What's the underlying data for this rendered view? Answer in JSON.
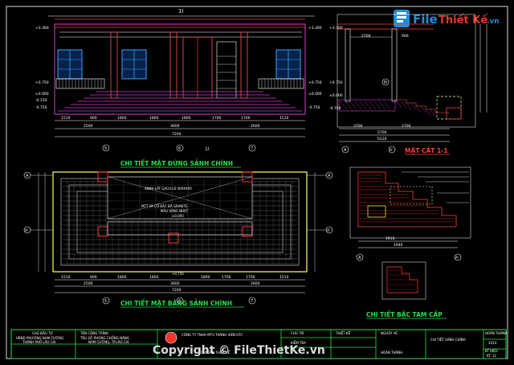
{
  "watermark": {
    "logo_word1": "File",
    "logo_word2": "Thiết Kế",
    "logo_domain": ".vn",
    "copyright": "Copyright © FileThietKe.vn"
  },
  "elevation": {
    "section_mark": "1I",
    "section_mark_bottom": "1I",
    "levels": [
      "+3.300",
      "+0.750",
      "±0.000",
      "-0.150",
      "-0.750"
    ],
    "dims_row1": [
      "1510",
      "900",
      "1800",
      "1800",
      "1800",
      "1700",
      "1700",
      "1510"
    ],
    "dims_row2": [
      "2500",
      "3600",
      "2600"
    ],
    "dims_row3": [
      "7200"
    ],
    "axes": [
      "5",
      "6",
      "7"
    ],
    "title": "CHI TIẾT MẶT ĐỨNG SẢNH CHÍNH"
  },
  "section": {
    "label_n": "N",
    "dims_top": [
      "2700",
      "900"
    ],
    "dims_bottom": [
      "3700",
      "2700",
      "5700",
      "6120"
    ],
    "levels": [
      "+3.300",
      "+0.750",
      "±0.000",
      "-0.750"
    ],
    "axes": [
      "A",
      "A'",
      "B"
    ],
    "title": "MẶT CẮT 1-1"
  },
  "plan": {
    "axes_left": [
      "A",
      "A'"
    ],
    "axes_right": [
      "A",
      "A'"
    ],
    "axes_bottom": [
      "5",
      "6",
      "7"
    ],
    "notes": [
      "SNNH LÁT GẠCH LD 400X400",
      "MTT VÀ CỔ BẬC ĐÁ GRANITE",
      "MÀU VÀNG NHẠT",
      "±0.000",
      "+0.750"
    ],
    "dims_row1": [
      "1510",
      "900",
      "1800",
      "1800",
      "1800",
      "1700",
      "1700",
      "1510"
    ],
    "dims_row2": [
      "2500",
      "3600",
      "2600"
    ],
    "dims_row3": [
      "7200"
    ],
    "title": "CHI TIẾT MẶT BẰNG SẢNH CHÍNH"
  },
  "stair_detail": {
    "dims": [
      "1910",
      "1940"
    ],
    "axes": [
      "A",
      "A'"
    ],
    "title": "CHI TIẾT BẬC TAM CẤP"
  },
  "title_block": {
    "col1": [
      "CHỦ ĐẦU TƯ",
      "UBND PHƯỜNG NAM CƯỜNG",
      "THÀNH PHỐ LÀO CAI"
    ],
    "col2": [
      "TÊN CÔNG TRÌNH",
      "TRỤ SỞ PHÒNG CHỐNG NĂNG",
      "NAM CƯỜNG, TP.LÀO CAI"
    ],
    "col3": [
      "CÔNG TY TNHH MTV THÀNH VIÊN HTC",
      "CHỈ DẪN THIẾT KẾ"
    ],
    "col4": [
      "CHỦ TRÌ",
      "THIẾT KẾ",
      "KIỂM TRA"
    ],
    "col5": [
      "NGƯỜI VẼ",
      "HOÀN THÀNH"
    ],
    "col6": [
      "CHI TIẾT SẢNH CHÍNH"
    ],
    "col7": [
      "HOÀN THÀNH",
      "2014",
      "KT HIỆU",
      "KT: 12"
    ]
  }
}
